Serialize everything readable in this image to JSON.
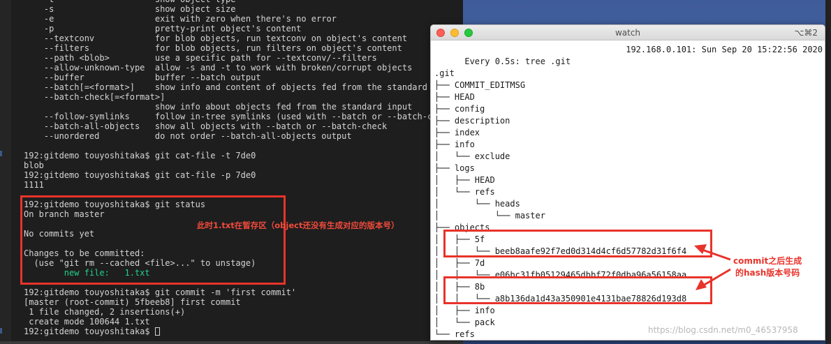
{
  "left_terminal": {
    "lines": [
      {
        "text": "    -t                    show object type",
        "style": "normal"
      },
      {
        "text": "    -s                    show object size",
        "style": "normal"
      },
      {
        "text": "    -e                    exit with zero when there's no error",
        "style": "normal"
      },
      {
        "text": "    -p                    pretty-print object's content",
        "style": "normal"
      },
      {
        "text": "    --textconv            for blob objects, run textconv on object's content",
        "style": "normal"
      },
      {
        "text": "    --filters             for blob objects, run filters on object's content",
        "style": "normal"
      },
      {
        "text": "    --path <blob>         use a specific path for --textconv/--filters",
        "style": "normal"
      },
      {
        "text": "    --allow-unknown-type  allow -s and -t to work with broken/corrupt objects",
        "style": "normal"
      },
      {
        "text": "    --buffer              buffer --batch output",
        "style": "normal"
      },
      {
        "text": "    --batch[=<format>]    show info and content of objects fed from the standard input",
        "style": "normal"
      },
      {
        "text": "    --batch-check[=<format>]",
        "style": "normal"
      },
      {
        "text": "                          show info about objects fed from the standard input",
        "style": "normal"
      },
      {
        "text": "    --follow-symlinks     follow in-tree symlinks (used with --batch or --batch-check)",
        "style": "normal"
      },
      {
        "text": "    --batch-all-objects   show all objects with --batch or --batch-check",
        "style": "normal"
      },
      {
        "text": "    --unordered           do not order --batch-all-objects output",
        "style": "normal"
      },
      {
        "text": "",
        "style": "normal"
      },
      {
        "text": "192:gitdemo touyoshitaka$ git cat-file -t 7de0",
        "style": "normal"
      },
      {
        "text": "blob",
        "style": "normal"
      },
      {
        "text": "192:gitdemo touyoshitaka$ git cat-file -p 7de0",
        "style": "normal"
      },
      {
        "text": "1111",
        "style": "normal"
      },
      {
        "text": "",
        "style": "normal"
      },
      {
        "text": "192:gitdemo touyoshitaka$ git status",
        "style": "normal"
      },
      {
        "text": "On branch master",
        "style": "normal"
      },
      {
        "text": "",
        "style": "normal"
      },
      {
        "text": "No commits yet",
        "style": "normal"
      },
      {
        "text": "",
        "style": "normal"
      },
      {
        "text": "Changes to be committed:",
        "style": "normal"
      },
      {
        "text": "  (use \"git rm --cached <file>...\" to unstage)",
        "style": "normal"
      },
      {
        "text": "        new file:   1.txt",
        "style": "green"
      },
      {
        "text": "",
        "style": "normal"
      },
      {
        "text": "192:gitdemo touyoshitaka$ git commit -m 'first commit'",
        "style": "normal"
      },
      {
        "text": "[master (root-commit) 5fbeeb8] first commit",
        "style": "normal"
      },
      {
        "text": " 1 file changed, 2 insertions(+)",
        "style": "normal"
      },
      {
        "text": " create mode 100644 1.txt",
        "style": "normal"
      }
    ],
    "prompt": "192:gitdemo touyoshitaka$ "
  },
  "watch_window": {
    "title": "watch",
    "shortcut": "⌥⌘2",
    "header_left": "Every 0.5s: tree .git",
    "header_right": "192.168.0.101: Sun Sep 20 15:22:56 2020",
    "tree_lines": [
      "",
      ".git",
      "├── COMMIT_EDITMSG",
      "├── HEAD",
      "├── config",
      "├── description",
      "├── index",
      "├── info",
      "│   └── exclude",
      "├── logs",
      "│   ├── HEAD",
      "│   └── refs",
      "│       └── heads",
      "│           └── master",
      "├── objects",
      "│   ├── 5f",
      "│   │   └── beeb8aafe92f7ed0d314d4cf6d57782d31f6f4",
      "│   ├── 7d",
      "│   │   └── e06bc31fb05129465dbbf72f0dba96a56158aa",
      "│   ├── 8b",
      "│   │   └── a8b136da1d43a350901e4131bae78826d193d8",
      "│   ├── info",
      "│   └── pack",
      "└── refs"
    ]
  },
  "annotations": {
    "status_note": "此时1.txt在暂存区（object还没有生成对应的版本号）",
    "commit_note_line1": "commit之后生成",
    "commit_note_line2": "的hash版本号码",
    "color": "#e8332a"
  },
  "watermark": "https://blog.csdn.net/m0_46537958"
}
